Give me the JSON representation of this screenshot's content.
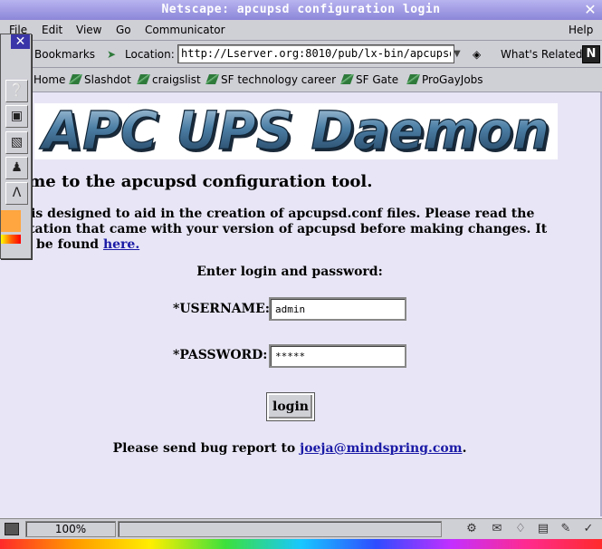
{
  "window": {
    "title": "Netscape: apcupsd configuration login",
    "close_glyph": "✕"
  },
  "menu": {
    "file": "File",
    "edit": "Edit",
    "view": "View",
    "go": "Go",
    "communicator": "Communicator",
    "help": "Help"
  },
  "location_bar": {
    "bookmarks": "Bookmarks",
    "location_label": "Location:",
    "url": "http://Lserver.org:8010/pub/lx-bin/apcupsd",
    "whats_related": "What's Related",
    "logo_letter": "N"
  },
  "bookmarks": [
    "Home",
    "Slashdot",
    "craigslist",
    "SF technology career",
    "SF Gate",
    "ProGayJobs"
  ],
  "page": {
    "logo_text": "APC UPS Daemon",
    "heading": "elcome to the apcupsd configuration tool.",
    "para_line1": "s tool is designed to aid in the creation of apcupsd.conf files. Please read the",
    "para_line2": "umentation that came with your version of apcupsd before making changes. It",
    "para_line3_prefix": "be found",
    "para_link": "here.",
    "prompt": "Enter login and password:",
    "username_label": "*USERNAME:",
    "username_value": "admin",
    "password_label": "*PASSWORD:",
    "password_value": "*****",
    "login_button": "login",
    "bug_prefix": "Please send bug report to",
    "bug_email": "joeja@mindspring.com",
    "bug_suffix": "."
  },
  "status_bar": {
    "zoom": "100%"
  },
  "colors": {
    "title_bar": "#8c86d8",
    "link": "#1a1aa6",
    "background": "#e8e6f6",
    "logo_blue": "#3a6a8e"
  }
}
